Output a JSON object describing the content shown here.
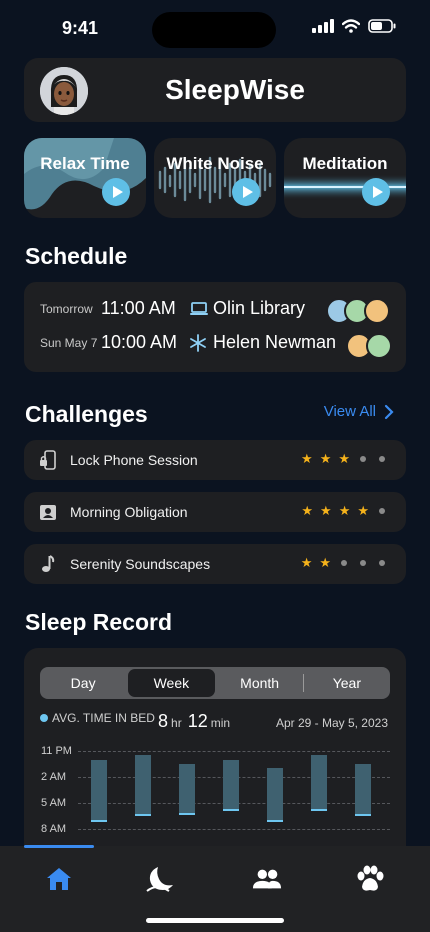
{
  "status_bar": {
    "time": "9:41"
  },
  "header": {
    "title": "SleepWise",
    "avatar_icon": "memoji-avatar-icon"
  },
  "media_cards": [
    {
      "label": "Relax Time",
      "icon": "play-icon"
    },
    {
      "label": "White Noise",
      "icon": "play-icon"
    },
    {
      "label": "Meditation",
      "icon": "play-icon"
    }
  ],
  "schedule": {
    "title": "Schedule",
    "items": [
      {
        "day": "Tomorrow",
        "time": "11:00 AM",
        "place": "Olin Library",
        "icon": "laptop-icon"
      },
      {
        "day": "Sun May 7",
        "time": "10:00 AM",
        "place": "Helen Newman",
        "icon": "snowflake-icon"
      }
    ]
  },
  "challenges": {
    "title": "Challenges",
    "view_all": "View All",
    "items": [
      {
        "label": "Lock Phone Session",
        "icon": "lock-phone-icon",
        "rating": 3,
        "max": 5
      },
      {
        "label": "Morning Obligation",
        "icon": "person-badge-icon",
        "rating": 4,
        "max": 5
      },
      {
        "label": "Serenity Soundscapes",
        "icon": "music-note-icon",
        "rating": 2,
        "max": 5
      }
    ]
  },
  "sleep_record": {
    "title": "Sleep Record",
    "tabs": [
      "Day",
      "Week",
      "Month",
      "Year"
    ],
    "active_tab": "Week",
    "legend_label": "AVG. TIME IN BED",
    "avg_hours": "8",
    "hr_unit": "hr",
    "avg_minutes": "12",
    "min_unit": "min",
    "date_range": "Apr 29 - May 5, 2023",
    "ticks": [
      "11 PM",
      "2 AM",
      "5 AM",
      "8 AM"
    ],
    "accent_color": "#6ec6f0"
  },
  "chart_data": {
    "type": "bar",
    "y_axis_ticks": [
      "11 PM",
      "2 AM",
      "5 AM",
      "8 AM"
    ],
    "unit": "hours after 11 PM (range bars: start to end)",
    "series": [
      {
        "start": 1.0,
        "end": 8.0
      },
      {
        "start": 0.5,
        "end": 7.3
      },
      {
        "start": 1.5,
        "end": 7.2
      },
      {
        "start": 1.0,
        "end": 6.7
      },
      {
        "start": 2.0,
        "end": 8.0
      },
      {
        "start": 0.5,
        "end": 6.7
      },
      {
        "start": 1.5,
        "end": 7.3
      }
    ]
  },
  "tab_bar": {
    "items": [
      {
        "icon": "home-icon",
        "active": true
      },
      {
        "icon": "moon-icon",
        "active": false
      },
      {
        "icon": "people-icon",
        "active": false
      },
      {
        "icon": "paw-icon",
        "active": false
      }
    ],
    "active_color": "#3a8bf0"
  }
}
